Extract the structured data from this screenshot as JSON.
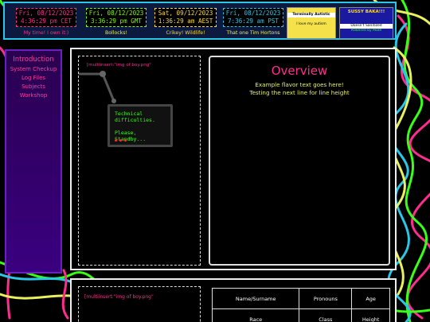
{
  "colors": {
    "accent_pink": "#ff2d8f",
    "accent_cyan": "#29c6e8",
    "accent_yellow": "#e8f060",
    "accent_green": "#39ff14",
    "sidebar_purple": "#3a0080",
    "header_blue": "#0d1a40"
  },
  "header": {
    "clocks": [
      {
        "line1": "Fri, 08/12/2023",
        "line2": "4:36:29 pm CET",
        "caption": "My time! I own it:)",
        "color": "#ff2d8f"
      },
      {
        "line1": "Fri, 08/12/2023",
        "line2": "3:36:29 pm GMT",
        "caption": "Bollocks!",
        "color": "#7cfc00"
      },
      {
        "line1": "Sat, 09/12/2023",
        "line2": "1:36:29 am AEST",
        "caption": "Crikey! Wildlife!",
        "color": "#ffd92d"
      },
      {
        "line1": "Fri, 08/12/2023",
        "line2": "7:36:29 am PST",
        "caption": "That one Tim Hortons",
        "color": "#29c6e8"
      }
    ],
    "badges": [
      {
        "lines": [
          "Terminally Autistic",
          "I love my autism"
        ],
        "bg": "#f5e24a"
      },
      {
        "lines": [
          "SUSSY BAKA!!!",
          "Doesn't Sanitized",
          "Powered by Math"
        ],
        "bg": "#1a1aa0"
      }
    ]
  },
  "sidebar": {
    "title": "Introduction",
    "items": [
      {
        "label": "System Checkup"
      },
      {
        "label": "Log Files"
      },
      {
        "label": "Subjects"
      },
      {
        "label": "Workshop"
      }
    ]
  },
  "main": {
    "image_placeholder": "[multiinsert:\"img of boy.png\"",
    "monitor_text": "Technical difficulties.\n\nPlease, Standby...",
    "monitor_led": "● ● ●",
    "overview_title": "Overview",
    "overview_lines": [
      "Example flavor text goes here!",
      "Testing the next line for line height"
    ]
  },
  "lower": {
    "image_placeholder": "[multiinsert:\"img of boy.png\"",
    "table": {
      "row1": [
        "Name/Surname",
        "Pronouns",
        "Age"
      ],
      "row2": [
        "Race",
        "Class",
        "Height"
      ]
    }
  }
}
